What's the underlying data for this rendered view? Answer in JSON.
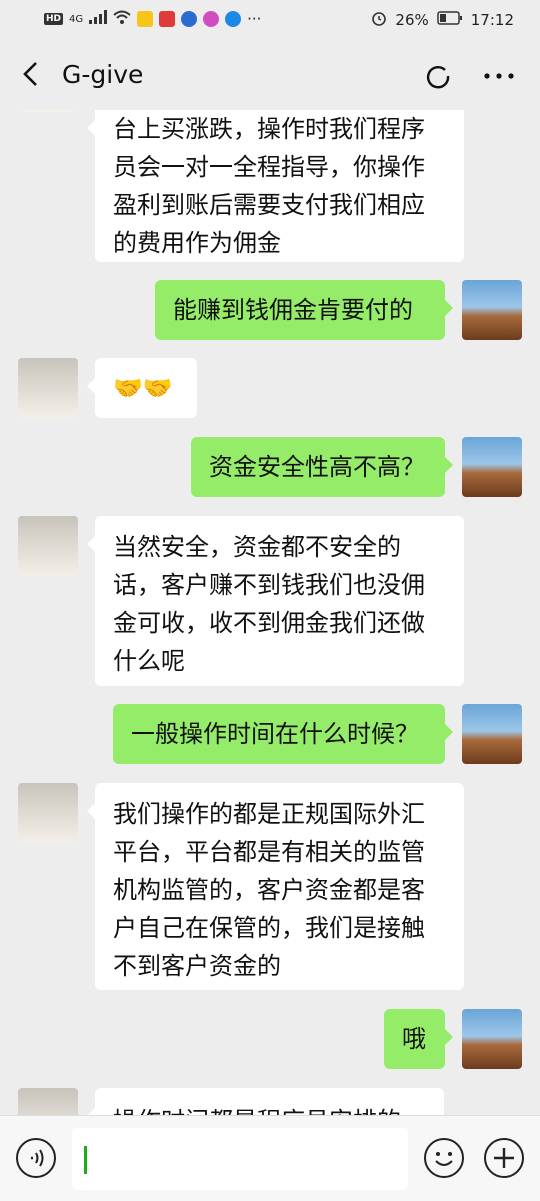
{
  "status_bar": {
    "hd_label": "HD",
    "network_label": "4G",
    "battery": "26%",
    "time": "17:12",
    "dots": "···"
  },
  "header": {
    "title": "G-give"
  },
  "messages": [
    {
      "side": "in",
      "text": "台上买涨跌，操作时我们程序员会一对一全程指导，你操作盈利到账后需要支付我们相应的费用作为佣金"
    },
    {
      "side": "out",
      "text": "能赚到钱佣金肯要付的"
    },
    {
      "side": "in",
      "text": "🤝🤝"
    },
    {
      "side": "out",
      "text": "资金安全性高不高？"
    },
    {
      "side": "in",
      "text": "当然安全，资金都不安全的话，客户赚不到钱我们也没佣金可收，收不到佣金我们还做什么呢"
    },
    {
      "side": "out",
      "text": "一般操作时间在什么时候？"
    },
    {
      "side": "in",
      "text": "我们操作的都是正规国际外汇平台，平台都是有相关的监管机构监管的，客户资金都是客户自己在保管的，我们是接触不到客户资金的"
    },
    {
      "side": "out",
      "text": "哦"
    },
    {
      "side": "in",
      "text": "操作时间都是程序员安排的"
    }
  ],
  "colors": {
    "out_bubble": "#95ec69",
    "in_bubble": "#ffffff",
    "background": "#ededed"
  }
}
